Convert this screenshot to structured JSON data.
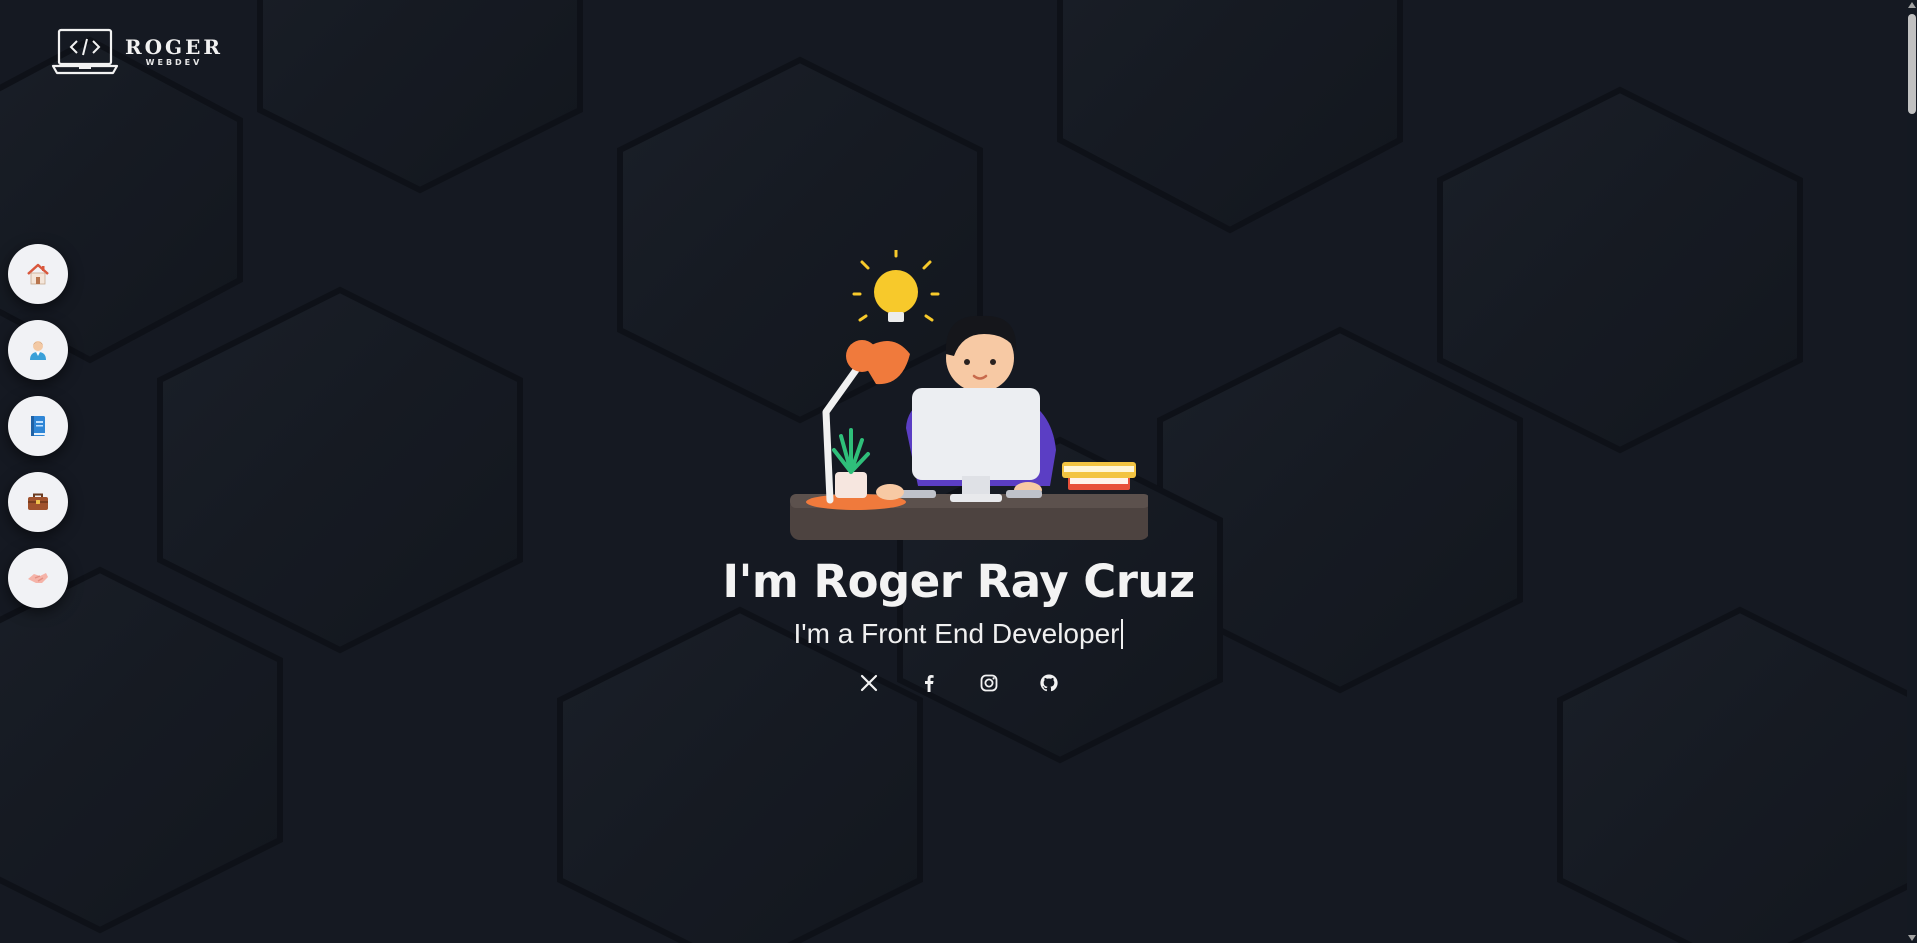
{
  "logo": {
    "name": "ROGER",
    "tagline": "WEBDEV",
    "icon": "laptop-code-icon"
  },
  "sidenav": {
    "items": [
      {
        "id": "home",
        "icon": "house-icon"
      },
      {
        "id": "about",
        "icon": "person-icon"
      },
      {
        "id": "resume",
        "icon": "book-icon"
      },
      {
        "id": "portfolio",
        "icon": "briefcase-icon"
      },
      {
        "id": "contact",
        "icon": "handshake-icon"
      }
    ]
  },
  "hero": {
    "illustration": "developer-at-desk-illustration",
    "title": "I'm Roger Ray Cruz",
    "subtitle": "I'm a Front End Developer",
    "socials": [
      {
        "id": "x",
        "icon": "x-twitter-icon"
      },
      {
        "id": "facebook",
        "icon": "facebook-icon"
      },
      {
        "id": "instagram",
        "icon": "instagram-icon"
      },
      {
        "id": "github",
        "icon": "github-icon"
      }
    ]
  },
  "colors": {
    "background": "#151922",
    "text": "#f2f2f2",
    "nav_button": "#f1f2f5"
  }
}
